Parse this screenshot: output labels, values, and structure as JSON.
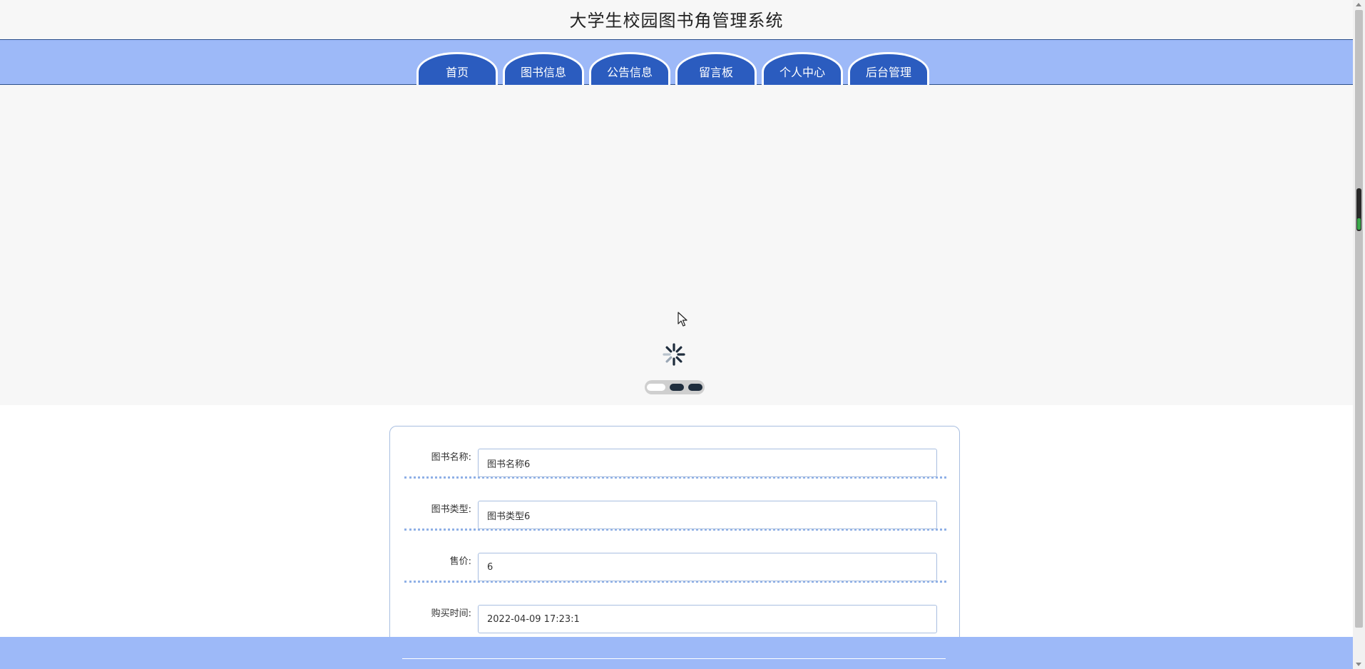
{
  "header": {
    "title": "大学生校园图书角管理系统"
  },
  "nav": {
    "tabs": [
      {
        "label": "首页"
      },
      {
        "label": "图书信息"
      },
      {
        "label": "公告信息"
      },
      {
        "label": "留言板"
      },
      {
        "label": "个人中心"
      },
      {
        "label": "后台管理"
      }
    ]
  },
  "carousel": {
    "indicator_count": 3,
    "active_index": 0,
    "loading": true
  },
  "form": {
    "fields": [
      {
        "label": "图书名称:",
        "value": "图书名称6"
      },
      {
        "label": "图书类型:",
        "value": "图书类型6"
      },
      {
        "label": "售价:",
        "value": "6"
      },
      {
        "label": "购买时间:",
        "value": "2022-04-09 17:23:1"
      }
    ]
  },
  "colors": {
    "nav_bg": "#9db9f8",
    "tab_bg": "#2b5cbf",
    "header_bg": "#f7f7f7",
    "field_border": "#a8bee0",
    "divider": "#8fb0e6"
  }
}
